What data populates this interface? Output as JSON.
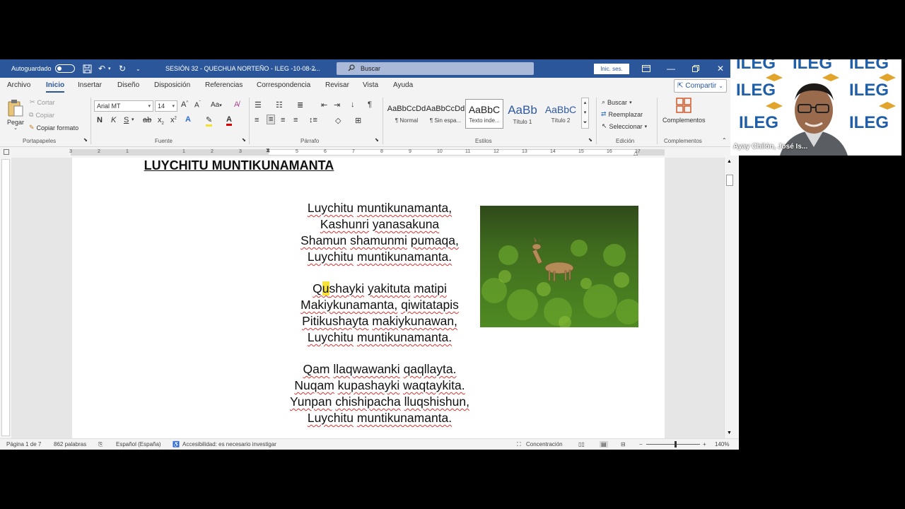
{
  "titlebar": {
    "autosave_label": "Autoguardado",
    "doc_title": "SESIÓN 32 - QUECHUA NORTEÑO - ILEG -10-08-2...",
    "search_placeholder": "Buscar",
    "signin_label": "Inic. ses."
  },
  "tabs": [
    "Archivo",
    "Inicio",
    "Insertar",
    "Diseño",
    "Disposición",
    "Referencias",
    "Correspondencia",
    "Revisar",
    "Vista",
    "Ayuda"
  ],
  "share_label": "Compartir",
  "ribbon": {
    "clipboard": {
      "paste": "Pegar",
      "cut": "Cortar",
      "copy": "Copiar",
      "format_painter": "Copiar formato",
      "group": "Portapapeles"
    },
    "font": {
      "name": "Arial MT",
      "size": "14",
      "group": "Fuente",
      "case": "Aa"
    },
    "paragraph": {
      "group": "Párrafo"
    },
    "styles": {
      "group": "Estilos",
      "items": [
        {
          "sample": "AaBbCcDd",
          "name": "¶ Normal"
        },
        {
          "sample": "AaBbCcDd",
          "name": "¶ Sin espa..."
        },
        {
          "sample": "AaBbC",
          "name": "Texto inde..."
        },
        {
          "sample": "AaBb",
          "name": "Título 1"
        },
        {
          "sample": "AaBbC",
          "name": "Título 2"
        }
      ]
    },
    "editing": {
      "find": "Buscar",
      "replace": "Reemplazar",
      "select": "Seleccionar",
      "group": "Edición"
    },
    "addins": {
      "label": "Complementos",
      "group": "Complementos"
    }
  },
  "ruler": {
    "ticks": [
      "3",
      "2",
      "1",
      "1",
      "2",
      "3",
      "4",
      "5",
      "6",
      "7",
      "8",
      "9",
      "10",
      "11",
      "12",
      "13",
      "14",
      "15",
      "16",
      "17"
    ]
  },
  "document": {
    "title": "LUYCHITU MUNTIKUNAMANTA",
    "stanza1": [
      "Luychitu muntikunamanta,",
      "Kashunri yanasakuna",
      "Shamun shamunmi pumaqa,",
      "Luychitu muntikunamanta."
    ],
    "stanza2": [
      "Qushayki yakituta matipi",
      "Makiykunamanta, qiwitatapis",
      "Pitikushayta makiykunawan,",
      "Luychitu muntikunamanta."
    ],
    "stanza3": [
      "Qam llaqwawanki qaqllayta.",
      "Nuqam kupashayki waqtaykita.",
      "Yunpan chishipacha lluqshishun,",
      "Luychitu muntikunamanta."
    ]
  },
  "statusbar": {
    "page": "Página 1 de 7",
    "words": "862 palabras",
    "language": "Español (España)",
    "accessibility": "Accesibilidad: es necesario investigar",
    "focus": "Concentración",
    "zoom": "140%"
  },
  "video": {
    "brand": "ILEG",
    "participant": "Ayay Chilón, José Is..."
  }
}
